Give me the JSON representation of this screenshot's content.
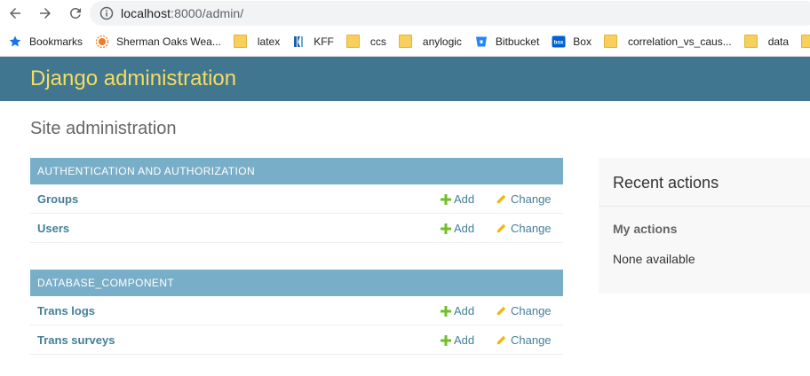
{
  "browser": {
    "url_host": "localhost",
    "url_path": ":8000/admin/",
    "bookmarks": [
      {
        "label": "Bookmarks",
        "icon": "star-icon"
      },
      {
        "label": "Sherman Oaks Wea...",
        "icon": "weather-icon"
      },
      {
        "label": "latex",
        "icon": "folder-icon"
      },
      {
        "label": "KFF",
        "icon": "kff-icon"
      },
      {
        "label": "ccs",
        "icon": "folder-icon"
      },
      {
        "label": "anylogic",
        "icon": "folder-icon"
      },
      {
        "label": "Bitbucket",
        "icon": "bitbucket-icon"
      },
      {
        "label": "Box",
        "icon": "box-icon"
      },
      {
        "label": "correlation_vs_caus...",
        "icon": "folder-icon"
      },
      {
        "label": "data",
        "icon": "folder-icon"
      }
    ]
  },
  "header": {
    "branding": "Django administration"
  },
  "content": {
    "title": "Site administration"
  },
  "modules": [
    {
      "caption": "Authentication and Authorization",
      "models": [
        {
          "name": "Groups",
          "add": "Add",
          "change": "Change"
        },
        {
          "name": "Users",
          "add": "Add",
          "change": "Change"
        }
      ]
    },
    {
      "caption": "Database_component",
      "models": [
        {
          "name": "Trans logs",
          "add": "Add",
          "change": "Change"
        },
        {
          "name": "Trans surveys",
          "add": "Add",
          "change": "Change"
        }
      ]
    }
  ],
  "sidebar": {
    "title": "Recent actions",
    "my_actions": "My actions",
    "empty": "None available"
  },
  "colors": {
    "header_bg": "#417690",
    "branding": "#f5dd5d",
    "caption_bg": "#79aec8",
    "link": "#447e9b",
    "add_icon": "#70bf2b",
    "change_icon": "#efb80b"
  }
}
